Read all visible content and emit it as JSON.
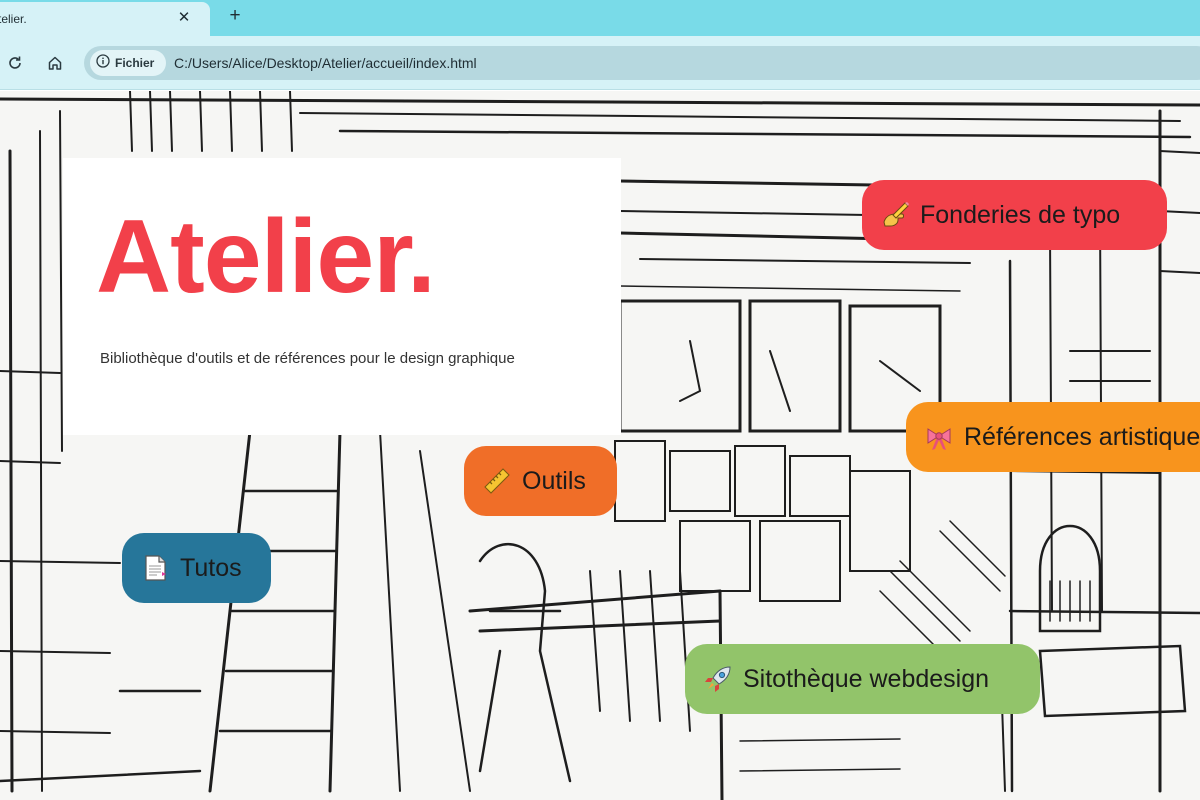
{
  "browser": {
    "tab": {
      "title": "telier.",
      "close_icon": "close-icon"
    },
    "new_tab_label": "+",
    "site_chip_label": "Fichier",
    "url": "C:/Users/Alice/Desktop/Atelier/accueil/index.html"
  },
  "hero": {
    "title": "Atelier.",
    "subtitle": "Bibliothèque d'outils et de références pour le design graphique"
  },
  "links": {
    "fonderies": "Fonderies de typo",
    "references": "Références artistiques",
    "outils": "Outils",
    "tutos": "Tutos",
    "sitotheque": "Sitothèque webdesign"
  },
  "colors": {
    "title_red": "#f2404a",
    "fonderies": "#f2404a",
    "references": "#f8941d",
    "outils": "#f06e28",
    "tutos": "#26769a",
    "sitotheque": "#92c46a"
  }
}
